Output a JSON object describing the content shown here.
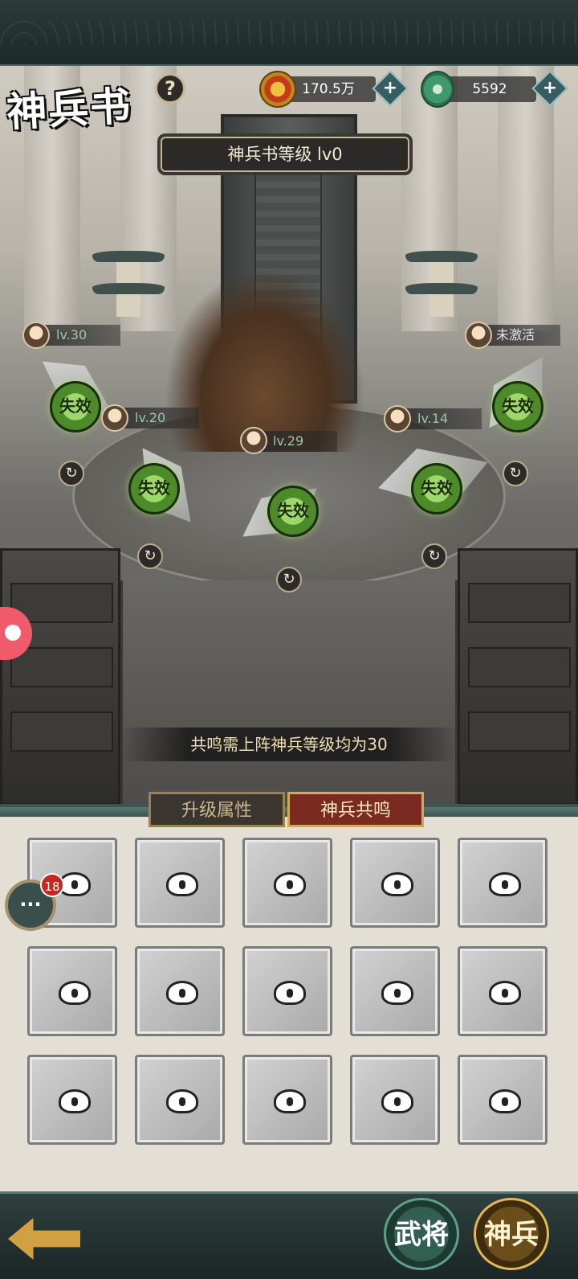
{
  "header": {
    "title": "神兵书",
    "help_label": "?",
    "gold_amount": "170.5万",
    "jade_amount": "5592",
    "plus_label": "+"
  },
  "book_level_label": "神兵书等级 lv0",
  "slots": [
    {
      "tag": "lv.30"
    },
    {
      "tag": "lv.20"
    },
    {
      "tag": "lv.29"
    },
    {
      "tag": "lv.14"
    },
    {
      "tag": "未激活"
    }
  ],
  "weapon_badge_label": "失效",
  "swap_icon": "↻",
  "resonance_requirement": "共鸣需上阵神兵等级均为30",
  "tabs": {
    "upgrade": "升级属性",
    "resonance": "神兵共鸣"
  },
  "chat": {
    "icon": "···",
    "badge": "18"
  },
  "bottom_nav": {
    "generals": "武将",
    "weapons": "神兵"
  }
}
